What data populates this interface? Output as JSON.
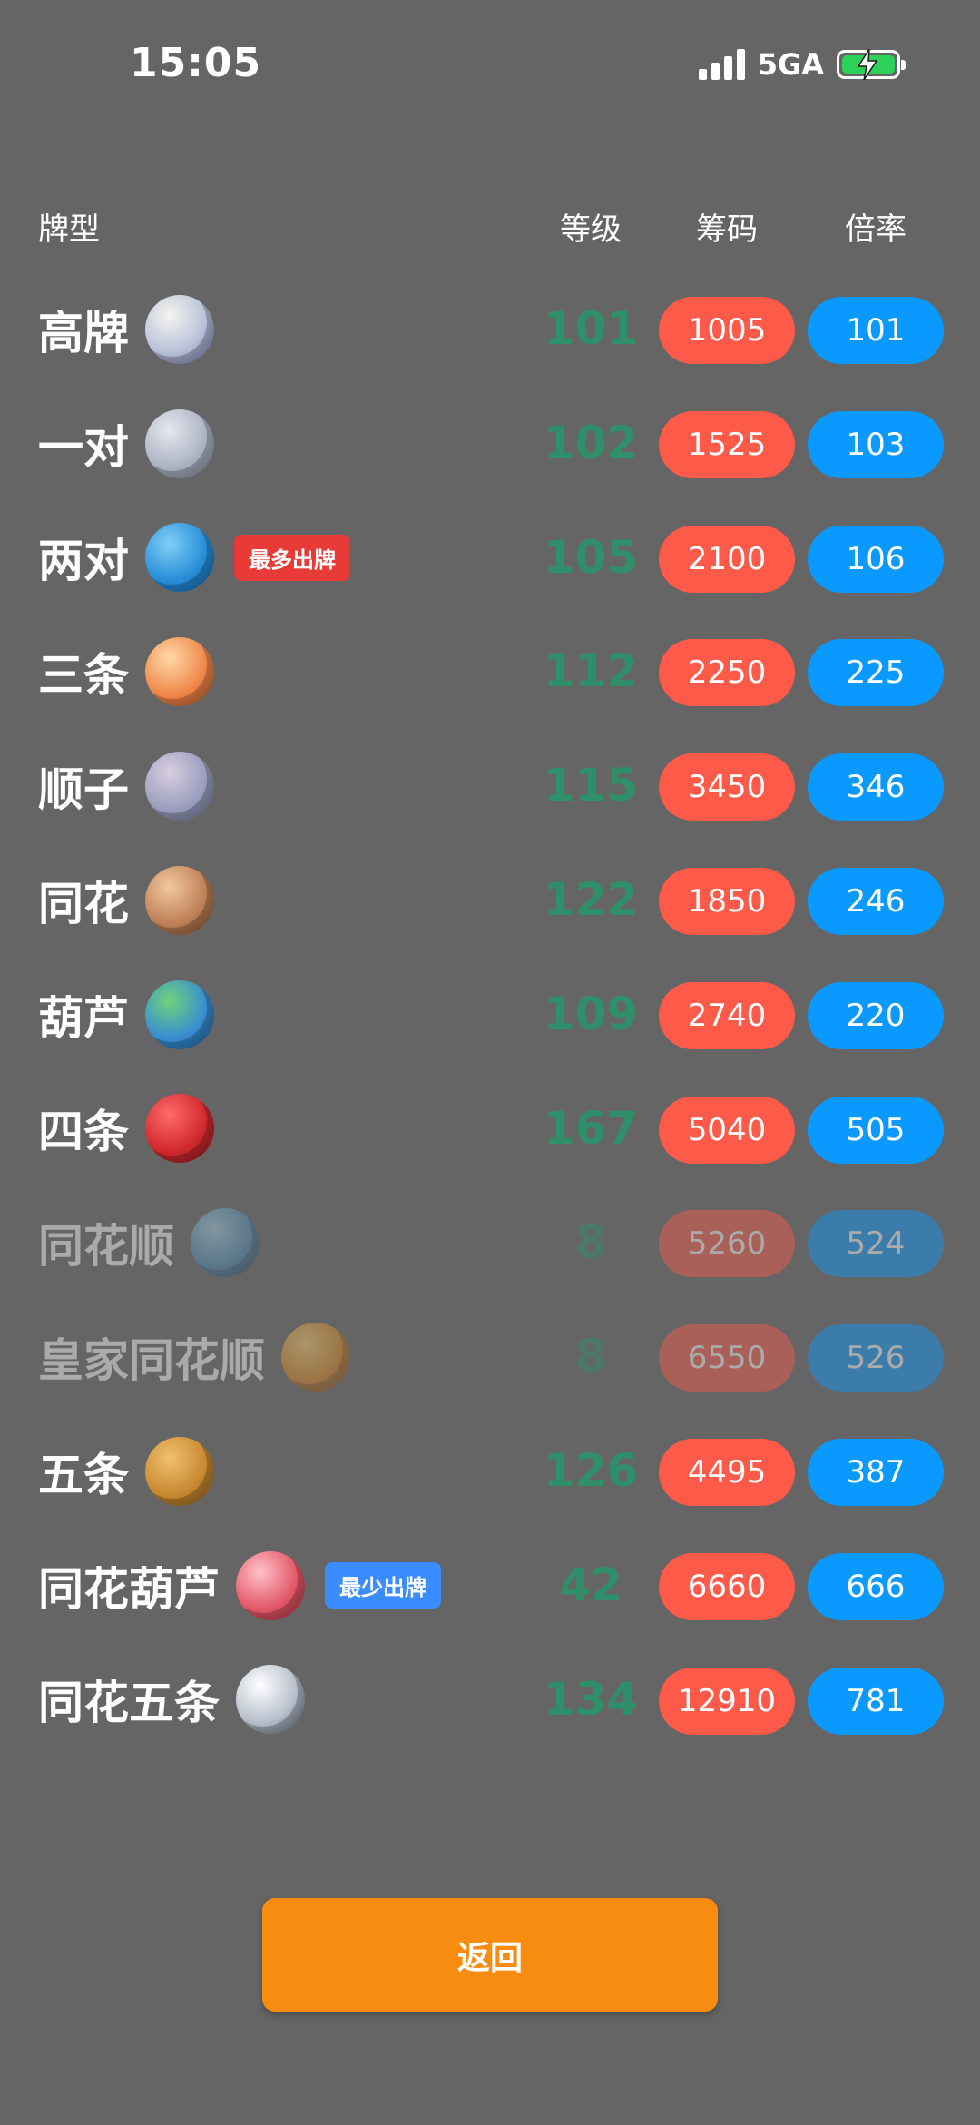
{
  "status_bar": {
    "time": "15:05",
    "network": "5GA"
  },
  "header": {
    "type": "牌型",
    "level": "等级",
    "chips": "筹码",
    "mult": "倍率"
  },
  "rows": [
    {
      "name": "高牌",
      "level": "101",
      "chips": "1005",
      "mult": "101",
      "tag": "",
      "planet_icon": "pale-planet-icon",
      "colors": [
        "#f5f3ee",
        "#b8c2d8",
        "#6f6aa6"
      ],
      "dim": false
    },
    {
      "name": "一对",
      "level": "102",
      "chips": "1525",
      "mult": "103",
      "tag": "",
      "planet_icon": "gray-moon-icon",
      "colors": [
        "#e5e8ef",
        "#aeb4c4",
        "#7a8096"
      ],
      "dim": false
    },
    {
      "name": "两对",
      "level": "105",
      "chips": "2100",
      "mult": "106",
      "tag": "最多出牌",
      "tag_type": "most",
      "planet_icon": "blue-ringed-planet-icon",
      "colors": [
        "#7fd0f7",
        "#2a8fd8",
        "#0d5fa8"
      ],
      "dim": false
    },
    {
      "name": "三条",
      "level": "112",
      "chips": "2250",
      "mult": "225",
      "tag": "",
      "planet_icon": "orange-swirl-planet-icon",
      "colors": [
        "#ffd8a8",
        "#f0894a",
        "#b9532a"
      ],
      "dim": false
    },
    {
      "name": "顺子",
      "level": "115",
      "chips": "3450",
      "mult": "346",
      "tag": "",
      "planet_icon": "ringed-saturn-icon",
      "colors": [
        "#d9cde0",
        "#9c9fbf",
        "#6c6f90"
      ],
      "dim": false
    },
    {
      "name": "同花",
      "level": "122",
      "chips": "1850",
      "mult": "246",
      "tag": "",
      "planet_icon": "banded-brown-planet-icon",
      "colors": [
        "#f2c8a0",
        "#c08258",
        "#7a5030"
      ],
      "dim": false
    },
    {
      "name": "葫芦",
      "level": "109",
      "chips": "2740",
      "mult": "220",
      "tag": "",
      "planet_icon": "earth-icon",
      "colors": [
        "#6fd27a",
        "#3a8fd0",
        "#1c5c9a"
      ],
      "dim": false
    },
    {
      "name": "四条",
      "level": "167",
      "chips": "5040",
      "mult": "505",
      "tag": "",
      "planet_icon": "red-planet-icon",
      "colors": [
        "#ff6a6a",
        "#d12a2f",
        "#8a1419"
      ],
      "dim": false
    },
    {
      "name": "同花顺",
      "level": "8",
      "chips": "5260",
      "mult": "524",
      "tag": "",
      "planet_icon": "blue-striped-planet-icon",
      "colors": [
        "#a8d4e8",
        "#4f8fb8",
        "#2a5a80"
      ],
      "dim": true
    },
    {
      "name": "皇家同花顺",
      "level": "8",
      "chips": "6550",
      "mult": "526",
      "tag": "",
      "planet_icon": "golden-planet-icon",
      "colors": [
        "#ffd070",
        "#e08a22",
        "#a0501a"
      ],
      "dim": true
    },
    {
      "name": "五条",
      "level": "126",
      "chips": "4495",
      "mult": "387",
      "tag": "",
      "planet_icon": "cookie-planet-icon",
      "colors": [
        "#f0c070",
        "#c98a32",
        "#8a5a1a"
      ],
      "dim": false
    },
    {
      "name": "同花葫芦",
      "level": "42",
      "chips": "6660",
      "mult": "666",
      "tag": "最少出牌",
      "tag_type": "least",
      "planet_icon": "pink-striped-planet-icon",
      "colors": [
        "#ffc0c8",
        "#e35a6a",
        "#a82a3a"
      ],
      "dim": false
    },
    {
      "name": "同花五条",
      "level": "134",
      "chips": "12910",
      "mult": "781",
      "tag": "",
      "planet_icon": "silver-disco-planet-icon",
      "colors": [
        "#ffffff",
        "#b8c0cc",
        "#5a6070"
      ],
      "dim": false
    }
  ],
  "back_button": {
    "label": "返回"
  },
  "colors": {
    "background": "#656565",
    "level_text": "#2f8f6b",
    "chips_pill": "#fd5a4a",
    "mult_pill": "#0a99ff",
    "back_button": "#f78c10",
    "tag_most": "#e83a37",
    "tag_least": "#3b8cff"
  }
}
